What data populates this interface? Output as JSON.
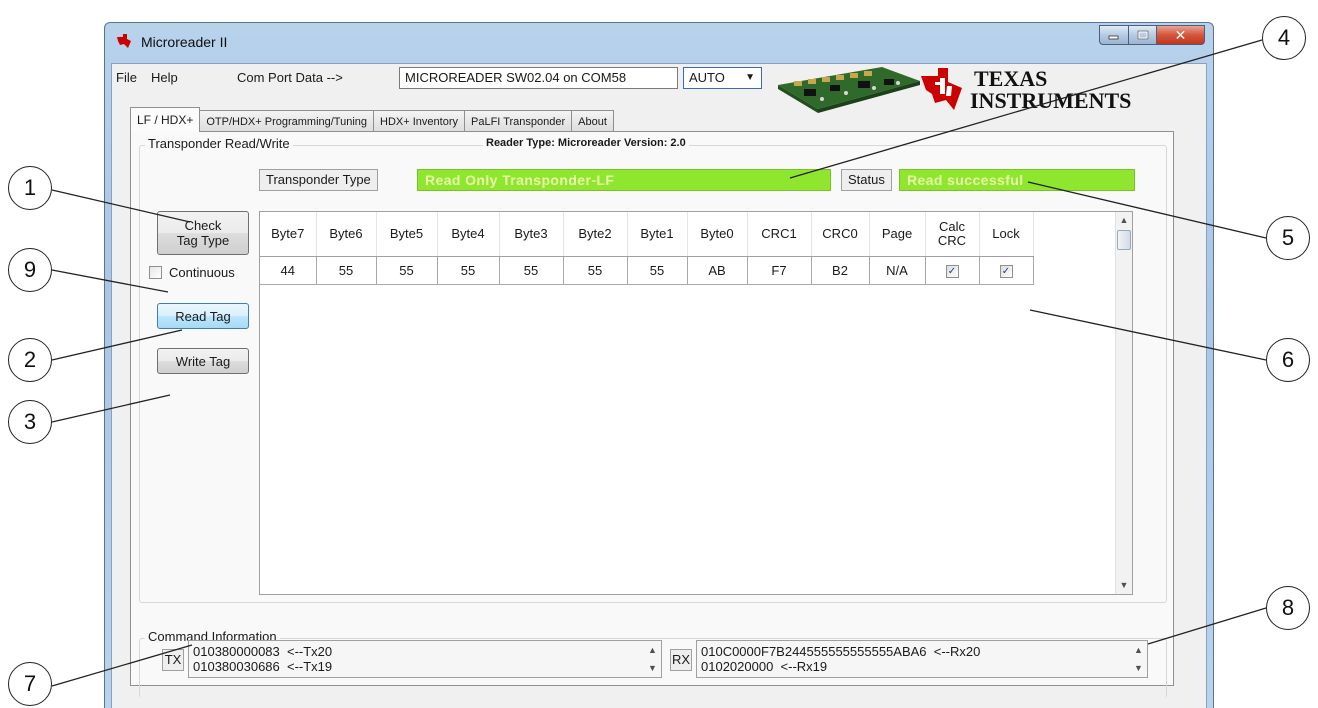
{
  "window": {
    "title": "Microreader II"
  },
  "menu": {
    "items": [
      "File",
      "Help"
    ]
  },
  "com_port": {
    "label": "Com Port Data -->",
    "value": "MICROREADER SW02.04 on COM58",
    "mode": "AUTO"
  },
  "logo": {
    "line1": "TEXAS",
    "line2": "INSTRUMENTS",
    "brand_color": "#cc0000"
  },
  "tabs": [
    "LF / HDX+",
    "OTP/HDX+ Programming/Tuning",
    "HDX+ Inventory",
    "PaLFI Transponder",
    "About"
  ],
  "rw_group": {
    "title": "Transponder Read/Write",
    "reader_info": "Reader Type: Microreader   Version: 2.0",
    "transponder_type_label": "Transponder Type",
    "transponder_type_value": "Read Only Transponder-LF",
    "status_label": "Status",
    "status_value": "Read successful",
    "field_color": "#8fe62f"
  },
  "buttons": {
    "check_tag": "Check Tag Type",
    "read_tag": "Read Tag",
    "write_tag": "Write Tag"
  },
  "continuous": {
    "label": "Continuous",
    "checked": false
  },
  "grid": {
    "columns": [
      "Byte7",
      "Byte6",
      "Byte5",
      "Byte4",
      "Byte3",
      "Byte2",
      "Byte1",
      "Byte0",
      "CRC1",
      "CRC0",
      "Page",
      "Calc CRC",
      "Lock"
    ],
    "rows": [
      [
        "44",
        "55",
        "55",
        "55",
        "55",
        "55",
        "55",
        "AB",
        "F7",
        "B2",
        "N/A",
        true,
        true
      ]
    ]
  },
  "command_group": {
    "title": "Command Information",
    "tx_label": "TX",
    "tx_lines": [
      "010380000083  <--Tx20",
      "010380030686  <--Tx19"
    ],
    "rx_label": "RX",
    "rx_lines": [
      "010C0000F7B244555555555555ABA6  <--Rx20",
      "0102020000  <--Rx19"
    ]
  },
  "callouts": [
    "1",
    "2",
    "3",
    "4",
    "5",
    "6",
    "7",
    "8",
    "9"
  ]
}
